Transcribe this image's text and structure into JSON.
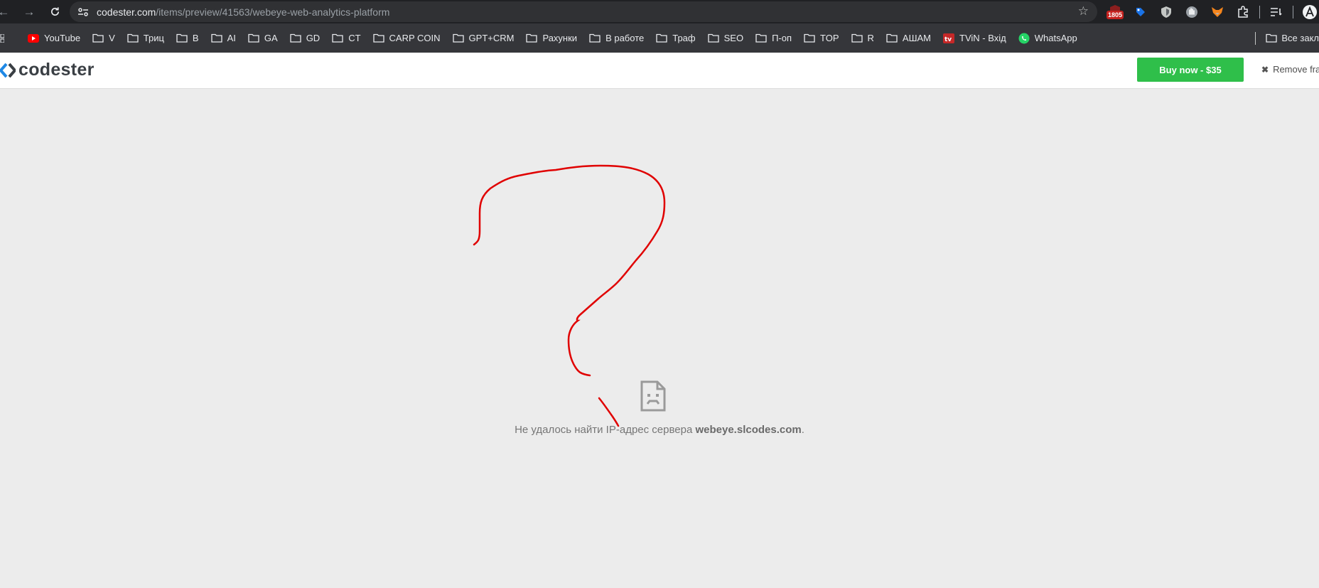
{
  "browser": {
    "url_host": "codester.com",
    "url_path": "/items/preview/41563/webeye-web-analytics-platform",
    "extension_badge": "1805",
    "bookmarks": [
      {
        "label": "YouTube",
        "icon": "youtube-icon"
      },
      {
        "label": "V",
        "icon": "folder-icon"
      },
      {
        "label": "Триц",
        "icon": "folder-icon"
      },
      {
        "label": "B",
        "icon": "folder-icon"
      },
      {
        "label": "AI",
        "icon": "folder-icon"
      },
      {
        "label": "GA",
        "icon": "folder-icon"
      },
      {
        "label": "GD",
        "icon": "folder-icon"
      },
      {
        "label": "CT",
        "icon": "folder-icon"
      },
      {
        "label": "CARP COIN",
        "icon": "folder-icon"
      },
      {
        "label": "GPT+CRM",
        "icon": "folder-icon"
      },
      {
        "label": "Рахунки",
        "icon": "folder-icon"
      },
      {
        "label": "В работе",
        "icon": "folder-icon"
      },
      {
        "label": "Траф",
        "icon": "folder-icon"
      },
      {
        "label": "SEO",
        "icon": "folder-icon"
      },
      {
        "label": "П-оп",
        "icon": "folder-icon"
      },
      {
        "label": "TOP",
        "icon": "folder-icon"
      },
      {
        "label": "R",
        "icon": "folder-icon"
      },
      {
        "label": "АШАМ",
        "icon": "folder-icon"
      },
      {
        "label": "TViN - Вхід",
        "icon": "tvin-icon"
      },
      {
        "label": "WhatsApp",
        "icon": "whatsapp-icon"
      }
    ],
    "all_bookmarks_label": "Все закл"
  },
  "frame": {
    "logo_text": "codester",
    "buy_label": "Buy now - $35",
    "remove_label": "Remove fra"
  },
  "error": {
    "message_prefix": "Не удалось найти IP-адрес сервера ",
    "server": "webeye.slcodes.com",
    "message_suffix": "."
  },
  "colors": {
    "accent_buy": "#2fbf4a",
    "logo_blue": "#1e88e5",
    "annotation_red": "#e00000"
  }
}
